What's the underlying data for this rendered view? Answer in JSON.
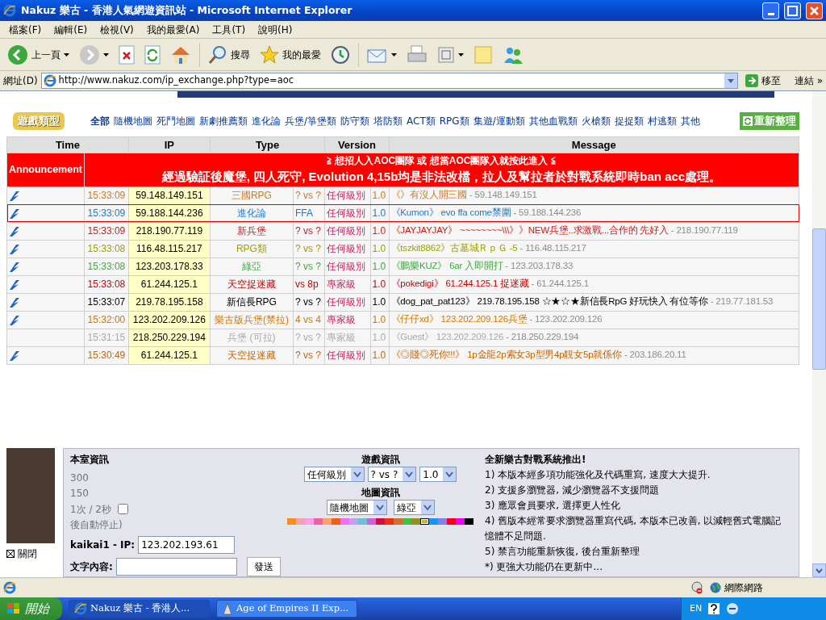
{
  "window": {
    "title": "Nakuz 樂古 - 香港人氣網遊資訊站 - Microsoft Internet Explorer"
  },
  "menu": [
    "檔案(F)",
    "編輯(E)",
    "檢視(V)",
    "我的最愛(A)",
    "工具(T)",
    "說明(H)"
  ],
  "toolbar": {
    "back": "上一頁",
    "search": "搜尋",
    "favorites": "我的最愛"
  },
  "address": {
    "label": "網址(D)",
    "url": "http://www.nakuz.com/ip_exchange.php?type=aoc",
    "go": "移至",
    "links": "連結",
    "more": "»"
  },
  "categories": {
    "logo": "遊戲類型",
    "refresh": "重新整理",
    "items": [
      {
        "label": "全部",
        "selected": true
      },
      {
        "label": "隨機地圖",
        "selected": false
      },
      {
        "label": "死鬥地圖",
        "selected": false
      },
      {
        "label": "新劇推薦類",
        "selected": false
      },
      {
        "label": "進化論",
        "selected": false
      },
      {
        "label": "兵堡/箏堡類",
        "selected": false
      },
      {
        "label": "防守類",
        "selected": false
      },
      {
        "label": "塔防類",
        "selected": false
      },
      {
        "label": "ACT類",
        "selected": false
      },
      {
        "label": "RPG類",
        "selected": false
      },
      {
        "label": "集遊/運動類",
        "selected": false
      },
      {
        "label": "其他血戰類",
        "selected": false
      },
      {
        "label": "火槍類",
        "selected": false
      },
      {
        "label": "捉捉類",
        "selected": false
      },
      {
        "label": "村逃類",
        "selected": false
      },
      {
        "label": "其他",
        "selected": false
      }
    ]
  },
  "table": {
    "columns": [
      "Time",
      "IP",
      "Type",
      "Version",
      "Message"
    ],
    "announcement": {
      "label": "Announcement",
      "lines": [
        "≧ 想招人入AOC團隊 或 想當AOC團隊入就按此進入 ≦",
        "經過驗証後魔堡, 四人死守, Evolution 4,15b均是非法改檔，拉人及幫拉者於對戰系統即時ban acc處理。"
      ]
    },
    "rows": [
      {
        "time": "15:33:09",
        "ip": "59.148.149.151",
        "type": "三國RPG",
        "vs": "? vs ?",
        "level": "任何級別",
        "version": "1.0",
        "message": "《》有沒人開三國",
        "source_ip": "- 59.148.149.151",
        "color": "#d2781e",
        "selected": false,
        "disabled": false
      },
      {
        "time": "15:33:09",
        "ip": "59.188.144.236",
        "type": "進化論",
        "vs": "FFA",
        "level": "任何級別",
        "version": "1.0",
        "message": "《Kumon》 evo ffa come禁圍",
        "source_ip": "- 59.188.144.236",
        "color": "#1e78c8",
        "selected": true,
        "disabled": false
      },
      {
        "time": "15:33:09",
        "ip": "218.190.77.119",
        "type": "新兵堡",
        "vs": "? vs ?",
        "level": "任何級別",
        "version": "1.0",
        "message": "《JAYJAYJAY》 ~~~~~~~~\\\\\\》》NEW兵堡..求激戰...合作的 先好入",
        "source_ip": "- 218.190.77.119",
        "color": "#c81e1e",
        "selected": false,
        "disabled": false
      },
      {
        "time": "15:33:08",
        "ip": "116.48.115.217",
        "type": "RPG類",
        "vs": "? vs ?",
        "level": "任何級別",
        "version": "1.0",
        "message": "《tszkit8862》古墓城ＲｐＧ -5",
        "source_ip": "- 116.48.115.217",
        "color": "#a0a000",
        "selected": false,
        "disabled": false
      },
      {
        "time": "15:33:08",
        "ip": "123.203.178.33",
        "type": "綠亞",
        "vs": "? vs ?",
        "level": "任何級別",
        "version": "1.0",
        "message": "《鵬樂KUZ》 6ar 入即開打",
        "source_ip": "- 123.203.178.33",
        "color": "#3caa3c",
        "selected": false,
        "disabled": false
      },
      {
        "time": "15:33:08",
        "ip": "61.244.125.1",
        "type": "天空捉迷藏",
        "vs": "vs 8p",
        "level": "專家級",
        "version": "1.0",
        "message": "《pokedigi》 61.244.125.1 捉迷藏",
        "source_ip": "- 61.244.125.1",
        "color": "#c80000",
        "selected": false,
        "disabled": false
      },
      {
        "time": "15:33:07",
        "ip": "219.78.195.158",
        "type": "新信長RPG",
        "vs": "? vs ?",
        "level": "任何級別",
        "version": "1.0",
        "message": "《dog_pat_pat123》 219.78.195.158 ☆★☆★新信長RpG 好玩快入 有位等你",
        "source_ip": "- 219.77.181.53",
        "color": "#000000",
        "selected": false,
        "disabled": false
      },
      {
        "time": "15:32:00",
        "ip": "123.202.209.126",
        "type": "樂古版兵堡(禁拉)",
        "vs": "4 vs 4",
        "level": "專家級",
        "version": "1.0",
        "message": "《仔仔xd》 123.202.209.126兵堡",
        "source_ip": "- 123.202.209.126",
        "color": "#d27800",
        "selected": false,
        "disabled": false
      },
      {
        "time": "15:31:15",
        "ip": "218.250.229.194",
        "type": "兵堡 (可拉)",
        "vs": "? vs ?",
        "level": "專家級",
        "version": "1.0",
        "message": "《Guest》 123.202.209.126",
        "source_ip": "- 218.250.229.194",
        "color": "#aaaaaa",
        "selected": false,
        "disabled": true
      },
      {
        "time": "15:30:49",
        "ip": "61.244.125.1",
        "type": "天空捉迷藏",
        "vs": "? vs ?",
        "level": "任何級別",
        "version": "1.0",
        "message": "《◎賤◎死你!!!》 1p金龍2p索女3p型男4p靚女5p就係你",
        "source_ip": "- 203.186.20.11",
        "color": "#c86400",
        "selected": false,
        "disabled": false
      }
    ]
  },
  "room": {
    "title": "本室資訊",
    "lines": [
      {
        "text": "300"
      },
      {
        "text": "150"
      },
      {
        "text": "1次 / 2秒",
        "checked": false
      },
      {
        "text": "後自動停止)"
      }
    ],
    "close": "關閉"
  },
  "user": {
    "name_label": "kaikai1 - IP:",
    "ip": "123.202.193.61",
    "message_label": "文字內容:",
    "send": "發送"
  },
  "game_info": {
    "title": "遊戲資訊",
    "selects": [
      "任何級別",
      "? vs ?",
      "1.0"
    ]
  },
  "map_info": {
    "title": "地圖資訊",
    "selects": [
      "隨機地圖",
      "綠亞"
    ],
    "colors": [
      {
        "color": "#f39020",
        "selected": false
      },
      {
        "color": "#f5a0b0",
        "selected": false
      },
      {
        "color": "#f8a0e8",
        "selected": false
      },
      {
        "color": "#f060a0",
        "selected": false
      },
      {
        "color": "#f8a070",
        "selected": false
      },
      {
        "color": "#f06010",
        "selected": false
      },
      {
        "color": "#f070f0",
        "selected": false
      },
      {
        "color": "#c0a0f0",
        "selected": false
      },
      {
        "color": "#70c0d0",
        "selected": false
      },
      {
        "color": "#d060e0",
        "selected": false
      },
      {
        "color": "#d01040",
        "selected": false
      },
      {
        "color": "#f03010",
        "selected": false
      },
      {
        "color": "#d07030",
        "selected": false
      },
      {
        "color": "#40c040",
        "selected": false
      },
      {
        "color": "#909020",
        "selected": false
      },
      {
        "color": "#d0b020",
        "selected": true
      },
      {
        "color": "#2090f0",
        "selected": false
      },
      {
        "color": "#8080f0",
        "selected": false
      },
      {
        "color": "#f00020",
        "selected": false
      },
      {
        "color": "#f000f0",
        "selected": false
      },
      {
        "color": "#000000",
        "selected": false
      }
    ]
  },
  "news": {
    "title": "全新樂古對戰系統推出!",
    "items": [
      "1) 本版本經多項功能強化及代碼重寫, 速度大大提升.",
      "2) 支援多瀏覽器, 減少瀏覽器不支援問題",
      "3) 應眾會員要求, 選擇更人性化",
      "4) 舊版本經常要求瀏覽器重寫代碼, 本版本已改善, 以減輕舊式電腦記憶體不足問題.",
      "5) 禁言功能重新恢復, 後台重新整理",
      "*) 更強大功能仍在更新中..."
    ]
  },
  "status_bar": {
    "zone": "網際網路"
  },
  "taskbar": {
    "start": "開始",
    "tasks": [
      {
        "label": "Nakuz 樂古 - 香港人...",
        "selected": true
      },
      {
        "label": "Age of Empires II Exp...",
        "selected": false
      }
    ],
    "language": "EN"
  }
}
